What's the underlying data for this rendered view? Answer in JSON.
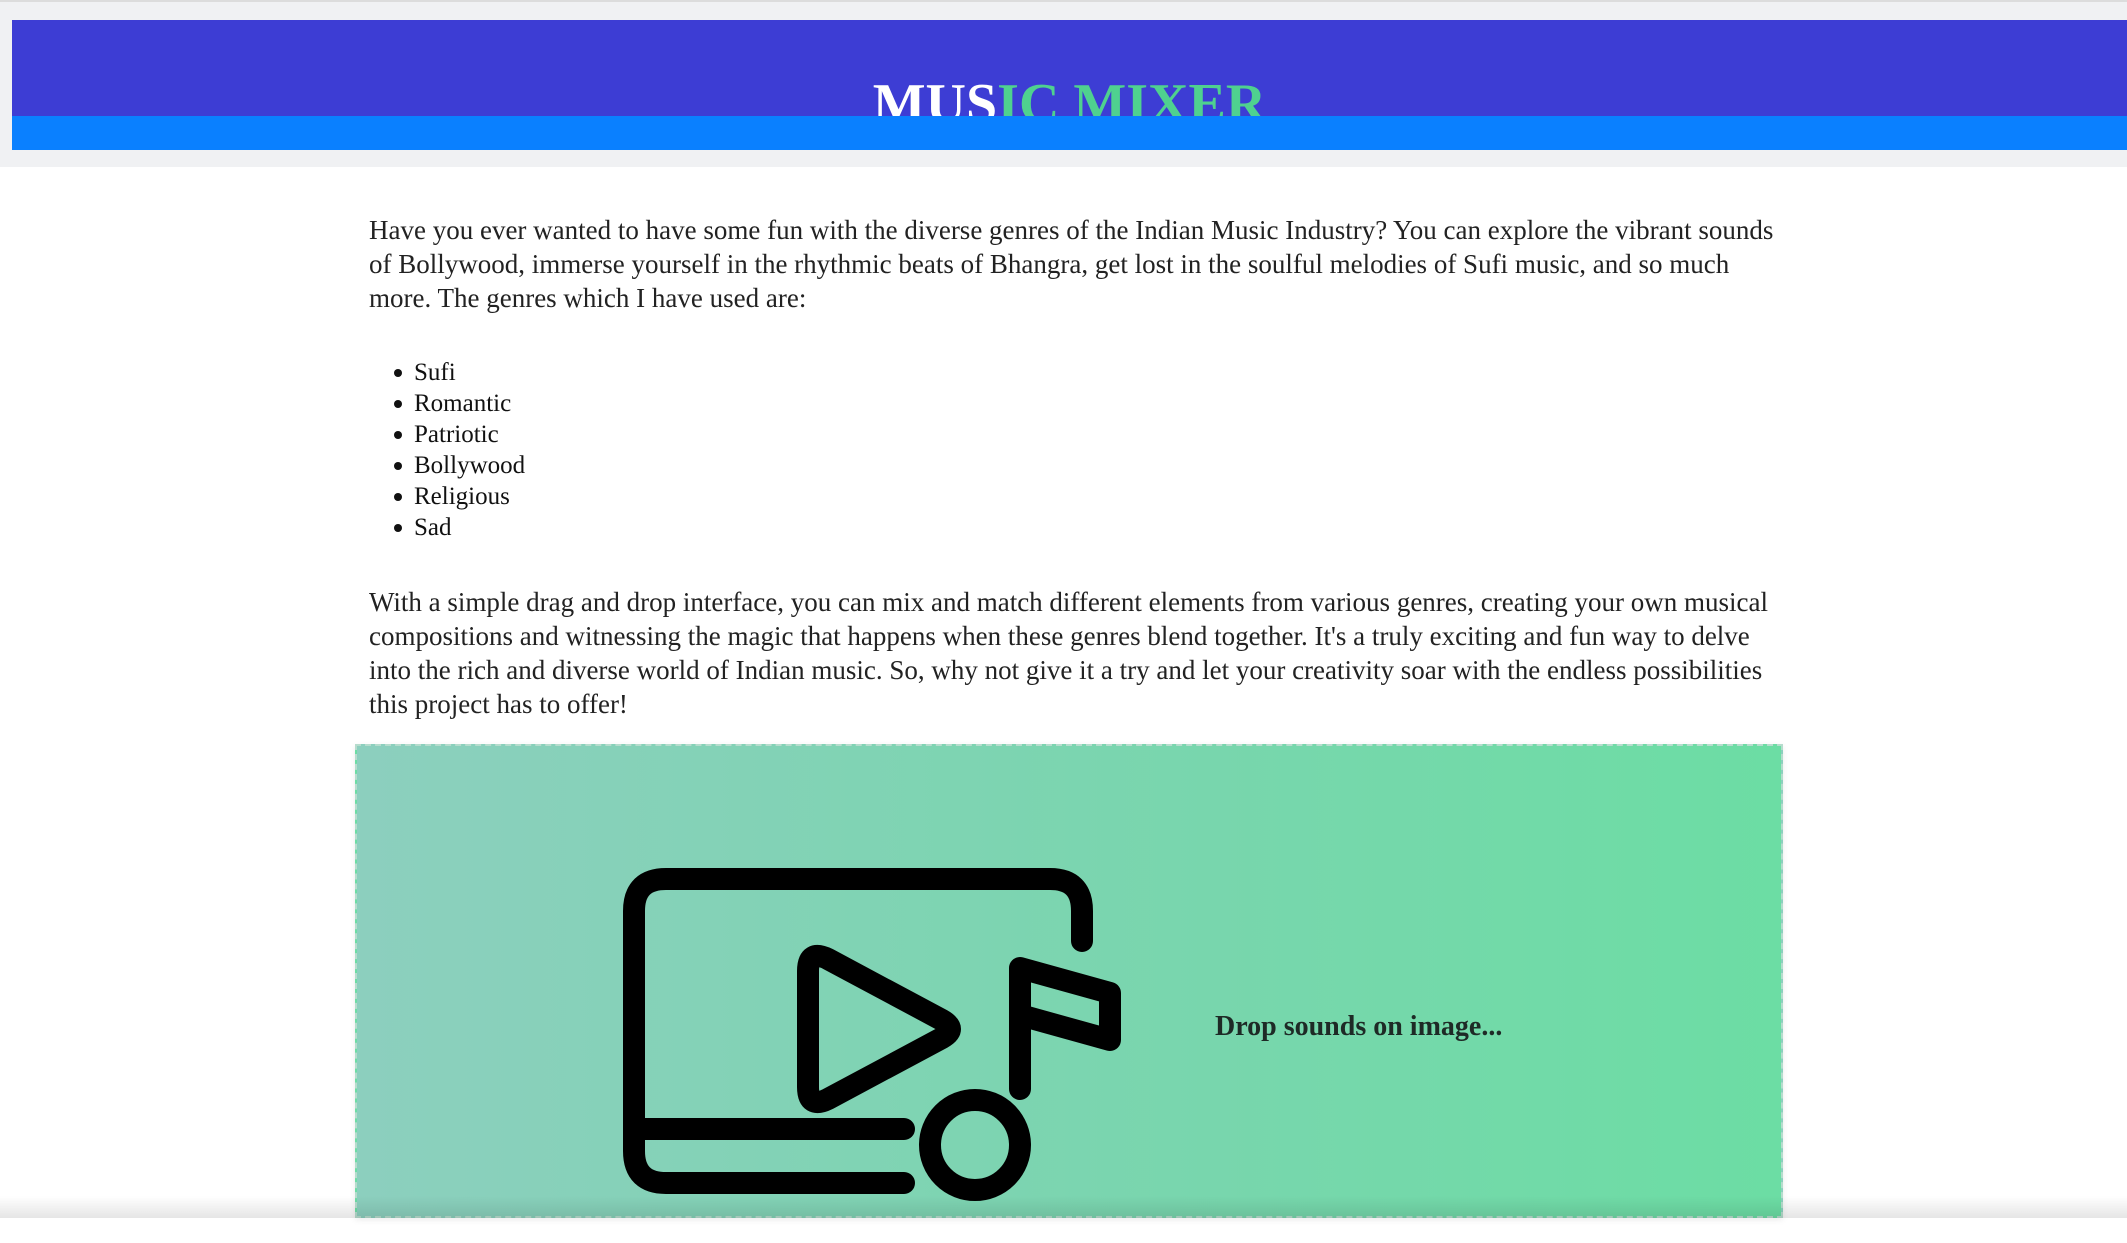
{
  "header": {
    "title_part1": "MUS",
    "title_part2": "IC MIXER",
    "title_color_white": "#ffffff",
    "title_color_green": "#4fd18f",
    "background": "#3d3dd4",
    "strip_color": "#0a80ff"
  },
  "content": {
    "intro": "Have you ever wanted to have some fun with the diverse genres of the Indian Music Industry? You can explore the vibrant sounds of Bollywood, immerse yourself in the rhythmic beats of Bhangra, get lost in the soulful melodies of Sufi music, and so much more. The genres which I have used are:",
    "genres": [
      "Sufi",
      "Romantic",
      "Patriotic",
      "Bollywood",
      "Religious",
      "Sad"
    ],
    "outro": "With a simple drag and drop interface, you can mix and match different elements from various genres, creating your own musical compositions and witnessing the magic that happens when these genres blend together. It's a truly exciting and fun way to delve into the rich and diverse world of Indian music. So, why not give it a try and let your creativity soar with the endless possibilities this project has to offer!"
  },
  "drop_zone": {
    "label": "Drop sounds on image...",
    "icon": "video-music-icon"
  }
}
